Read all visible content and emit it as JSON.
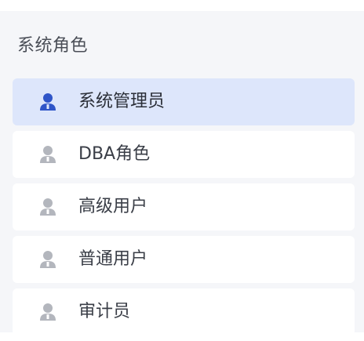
{
  "panel": {
    "title": "系统角色"
  },
  "roles": [
    {
      "label": "系统管理员",
      "icon": "user-icon",
      "active": true
    },
    {
      "label": "DBA角色",
      "icon": "user-icon",
      "active": false
    },
    {
      "label": "高级用户",
      "icon": "user-icon",
      "active": false
    },
    {
      "label": "普通用户",
      "icon": "user-icon",
      "active": false
    },
    {
      "label": "审计员",
      "icon": "user-icon",
      "active": false
    }
  ],
  "colors": {
    "active_icon": "#2f55c8",
    "inactive_icon": "#b3b6bd",
    "active_background": "#dde6fb",
    "panel_background": "#f5f6f9"
  }
}
